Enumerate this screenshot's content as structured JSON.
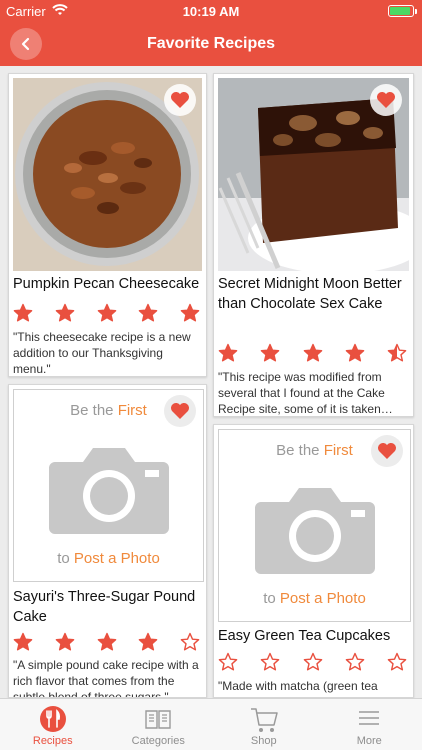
{
  "status_bar": {
    "carrier": "Carrier",
    "time": "10:19 AM"
  },
  "nav": {
    "title": "Favorite Recipes"
  },
  "recipes": [
    {
      "name": "Pumpkin Pecan Cheesecake",
      "rating": 5,
      "description": "\"This cheesecake recipe is a new addition to our Thanksgiving menu.\"",
      "has_photo": true
    },
    {
      "name": "Secret Midnight Moon Better than Chocolate Sex Cake",
      "rating": 4.5,
      "description": "\"This recipe was modified from several that I found at the Cake Recipe   site, some of it is taken…",
      "has_photo": true
    },
    {
      "name": "Sayuri's Three-Sugar Pound Cake",
      "rating": 4,
      "description": "\"A simple pound cake recipe with a rich flavor that comes from the subtle blend of three sugars.\"",
      "has_photo": false
    },
    {
      "name": "Easy Green Tea Cupcakes",
      "rating": 0,
      "description": "\"Made with matcha (green tea powder)...\"",
      "has_photo": false
    }
  ],
  "placeholder": {
    "be_the": "Be the ",
    "first": "First",
    "to": "to ",
    "post": "Post a Photo"
  },
  "tabs": [
    {
      "label": "Recipes",
      "icon": "fork-knife-icon",
      "active": true
    },
    {
      "label": "Categories",
      "icon": "menu-book-icon",
      "active": false
    },
    {
      "label": "Shop",
      "icon": "cart-icon",
      "active": false
    },
    {
      "label": "More",
      "icon": "hamburger-icon",
      "active": false
    }
  ],
  "colors": {
    "brand": "#e9503f",
    "accent": "#f08a3c",
    "star": "#e9503f"
  }
}
